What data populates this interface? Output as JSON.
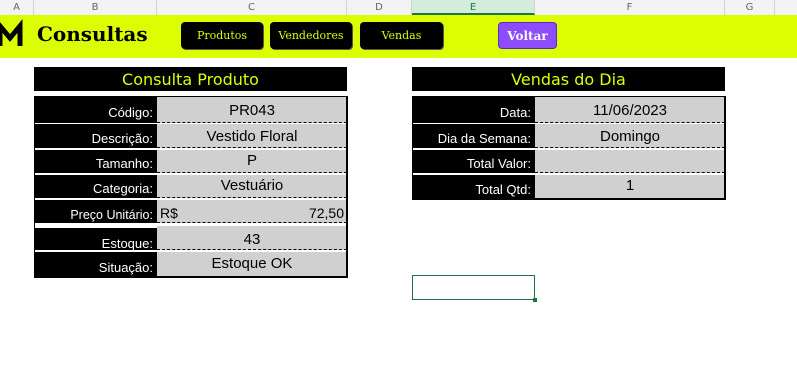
{
  "columns": [
    "A",
    "B",
    "C",
    "D",
    "E",
    "F",
    "G"
  ],
  "app": {
    "title": "Consultas"
  },
  "nav": {
    "produtos": "Produtos",
    "vendedores": "Vendedores",
    "vendas": "Vendas",
    "voltar": "Voltar"
  },
  "produto": {
    "title": "Consulta Produto",
    "codigo_label": "Código:",
    "codigo": "PR043",
    "descricao_label": "Descrição:",
    "descricao": "Vestido Floral",
    "tamanho_label": "Tamanho:",
    "tamanho": "P",
    "categoria_label": "Categoria:",
    "categoria": "Vestuário",
    "preco_label": "Preço Unitário:",
    "preco_currency": "R$",
    "preco": "72,50",
    "estoque_label": "Estoque:",
    "estoque": "43",
    "situacao_label": "Situação:",
    "situacao": "Estoque OK"
  },
  "vendas": {
    "title": "Vendas do Dia",
    "data_label": "Data:",
    "data": "11/06/2023",
    "dia_label": "Dia da Semana:",
    "dia": "Domingo",
    "total_valor_label": "Total Valor:",
    "total_valor": "",
    "total_qtd_label": "Total Qtd:",
    "total_qtd": "1"
  },
  "colors": {
    "accent": "#dbff00",
    "back_button": "#8b4dff",
    "label_bg": "#000000",
    "value_bg": "#d0d0d0"
  }
}
